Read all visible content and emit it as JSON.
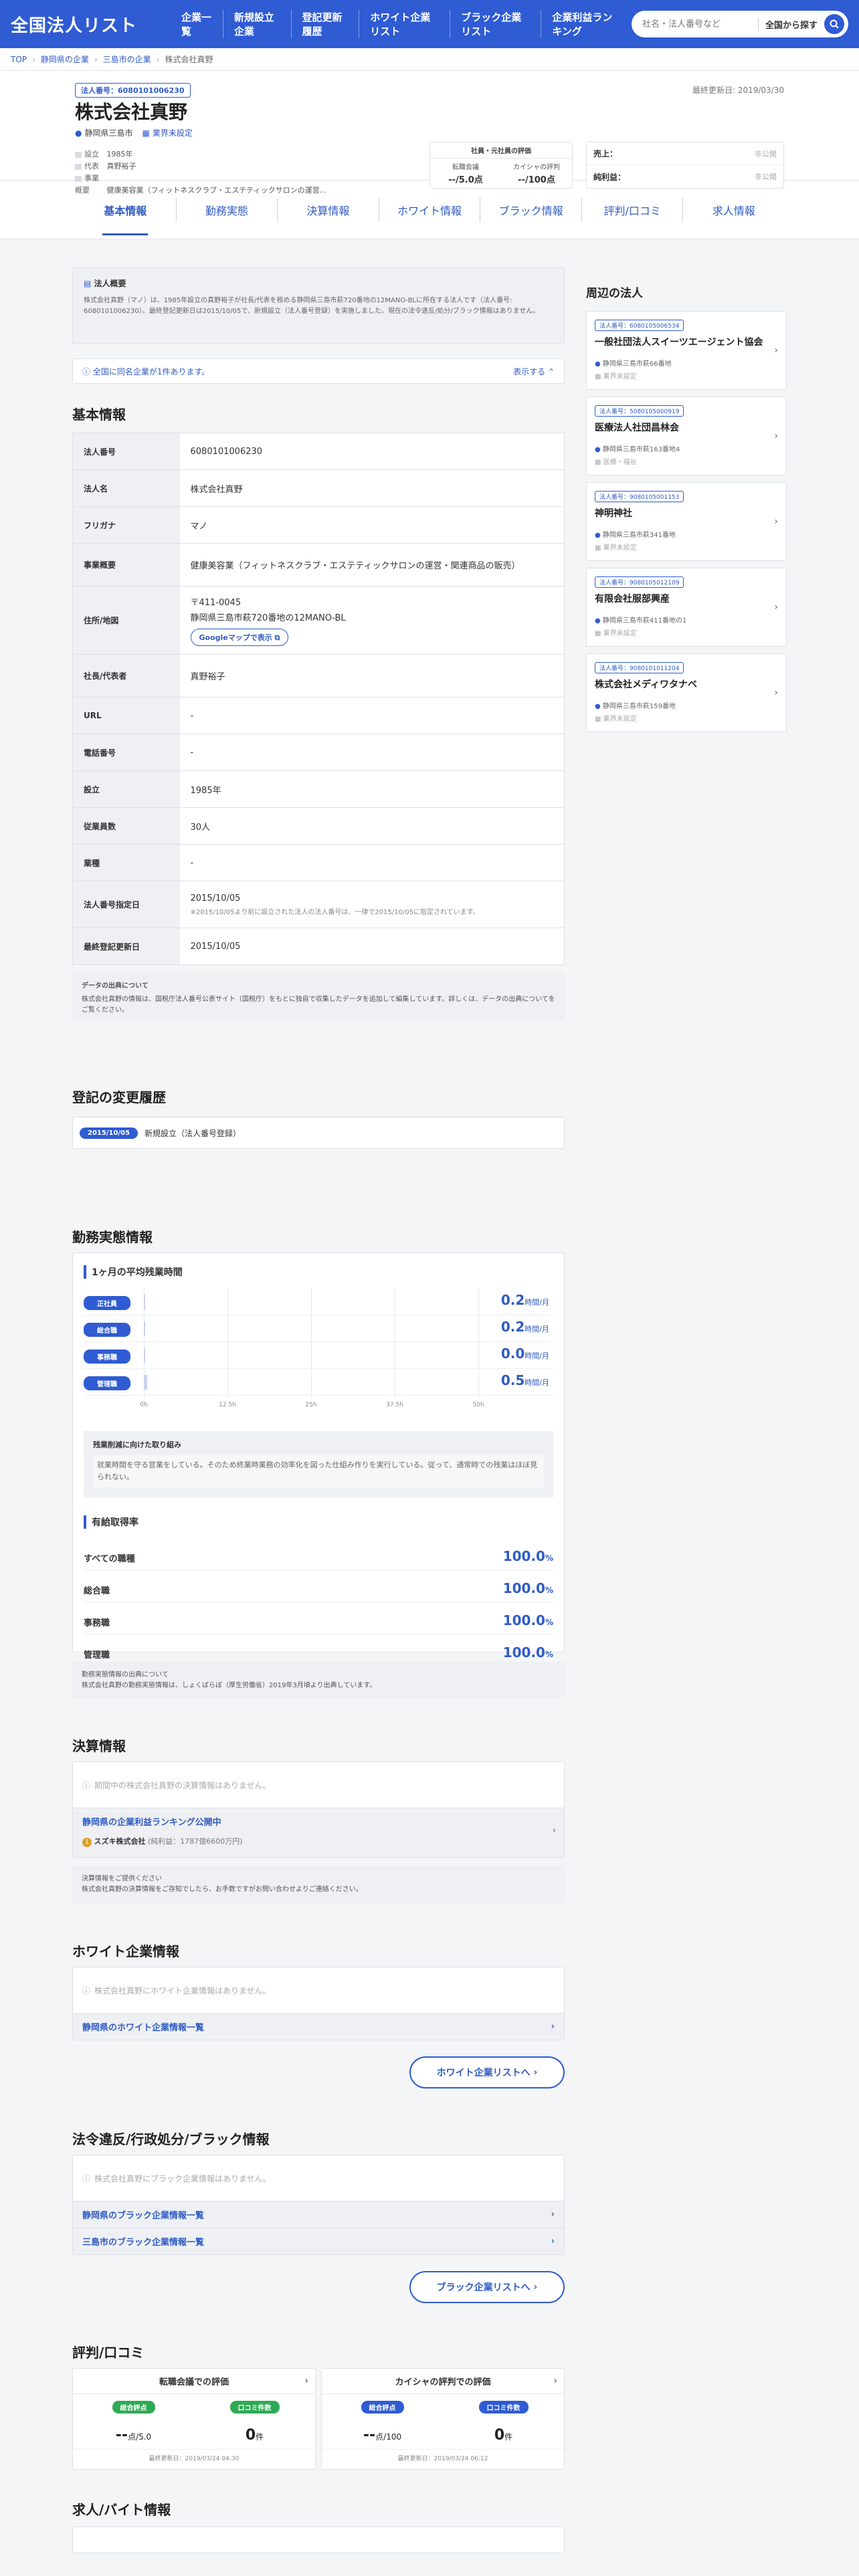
{
  "header": {
    "logo": "全国法人リスト",
    "nav": [
      "企業一覧",
      "新規設立企業",
      "登記更新履歴",
      "ホワイト企業リスト",
      "ブラック企業リスト",
      "企業利益ランキング"
    ],
    "search_placeholder": "社名・法人番号など",
    "search_scope": "全国から探す"
  },
  "breadcrumb": [
    "TOP",
    "静岡県の企業",
    "三島市の企業",
    "株式会社真野"
  ],
  "corp": {
    "number": "法人番号：6080101006230",
    "updated": "最終更新日: 2019/03/30",
    "name": "株式会社真野",
    "location": "静岡県三島市",
    "industry": "業界未設定",
    "founded_k": "設立",
    "founded_v": "1985年",
    "rep_k": "代表",
    "rep_v": "真野裕子",
    "biz_k": "事業概要",
    "biz_v": "健康美容業（フィットネスクラブ・エステティックサロンの運営...",
    "eval_title": "社員・元社員の評価",
    "eval1_k": "転職会議",
    "eval1_v": "--/5.0点",
    "eval2_k": "カイシャの評判",
    "eval2_v": "--/100点",
    "sales_k": "売上：",
    "sales_v": "非公開",
    "profit_k": "純利益：",
    "profit_v": "非公開"
  },
  "tabs": [
    "基本情報",
    "勤務実態",
    "決算情報",
    "ホワイト情報",
    "ブラック情報",
    "評判/口コミ",
    "求人情報"
  ],
  "summary": {
    "title": "法人概要",
    "text": "株式会社真野（マノ）は、1985年設立の真野裕子が社長/代表を務める静岡県三島市萩720番地の12MANO-BLに所在する法人です（法人番号: 6080101006230）。最終登記更新日は2015/10/05で、新規設立（法人番号登録）を実施しました。現在の法令違反/処分/ブラック情報はありません。"
  },
  "samename": {
    "text": "全国に同名企業が1件あります。",
    "action": "表示する"
  },
  "basic": {
    "title": "基本情報",
    "rows": [
      {
        "k": "法人番号",
        "v": "6080101006230"
      },
      {
        "k": "法人名",
        "v": "株式会社真野"
      },
      {
        "k": "フリガナ",
        "v": "マノ"
      },
      {
        "k": "事業概要",
        "v": "健康美容業（フィットネスクラブ・エステティックサロンの運営・関連商品の販売）"
      },
      {
        "k": "住所/地図",
        "v": "〒411-0045",
        "v2": "静岡県三島市萩720番地の12MANO-BL",
        "btn": "Googleマップで表示"
      },
      {
        "k": "社長/代表者",
        "v": "真野裕子"
      },
      {
        "k": "URL",
        "v": "-"
      },
      {
        "k": "電話番号",
        "v": "-"
      },
      {
        "k": "設立",
        "v": "1985年"
      },
      {
        "k": "従業員数",
        "v": "30人"
      },
      {
        "k": "業種",
        "v": "-"
      },
      {
        "k": "法人番号指定日",
        "v": "2015/10/05",
        "v2": "※2015/10/05より前に設立された法人の法人番号は、一律で2015/10/05に指定されています。"
      },
      {
        "k": "最終登記更新日",
        "v": "2015/10/05"
      }
    ]
  },
  "datasrc": {
    "title": "データの出典について",
    "text": "株式会社真野の情報は、国税庁法人番号公表サイト（国税庁）をもとに独自で収集したデータを追加して編集しています。詳しくは、データの出典についてをご覧ください。"
  },
  "history": {
    "title": "登記の変更履歴",
    "date": "2015/10/05",
    "event": "新規設立（法人番号登録）"
  },
  "work": {
    "title": "勤務実態情報",
    "overtime_title": "1ヶ月の平均残業時間",
    "chart_data": {
      "type": "bar",
      "categories": [
        "正社員",
        "総合職",
        "事務職",
        "管理職"
      ],
      "values": [
        0.2,
        0.2,
        0.0,
        0.5
      ],
      "value_labels": [
        "0.2",
        "0.2",
        "0.0",
        "0.5"
      ],
      "unit": "時間/月",
      "xlim": [
        0,
        50
      ],
      "ticks": [
        "0h",
        "12.5h",
        "25h",
        "37.5h",
        "50h"
      ]
    },
    "effort_title": "残業削減に向けた取り組み",
    "effort_text": "就業時間を守る営業をしている。そのため終業時業務の効率化を図った仕組み作りを実行している。従って、通常時での残業はほぼ見られない。",
    "leave_title": "有給取得率",
    "leave": [
      {
        "k": "すべての職種",
        "v": "100.0",
        "u": "%"
      },
      {
        "k": "総合職",
        "v": "100.0",
        "u": "%"
      },
      {
        "k": "事務職",
        "v": "100.0",
        "u": "%"
      },
      {
        "k": "管理職",
        "v": "100.0",
        "u": "%"
      }
    ],
    "src_title": "勤務実態情報の出典について",
    "src_text": "株式会社真野の勤務実態情報は、しょくばらぼ（厚生労働省）2019年3月頃より出典しています。"
  },
  "finance": {
    "title": "決算情報",
    "empty": "期間中の株式会社真野の決算情報はありません。",
    "rank_title": "静岡県の企業利益ランキング公開中",
    "rank_rank": "1",
    "rank_text": "スズキ株式会社",
    "rank_sub": "(純利益：1787億6600万円)",
    "note_title": "決算情報をご提供ください",
    "note_text": "株式会社真野の決算情報をご存知でしたら、お手数ですがお問い合わせよりご連絡ください。"
  },
  "white": {
    "title": "ホワイト企業情報",
    "empty": "株式会社真野にホワイト企業情報はありません。",
    "link": "静岡県のホワイト企業情報一覧",
    "btn": "ホワイト企業リストへ"
  },
  "black": {
    "title": "法令違反/行政処分/ブラック情報",
    "empty": "株式会社真野にブラック企業情報はありません。",
    "link1": "静岡県のブラック企業情報一覧",
    "link2": "三島市のブラック企業情報一覧",
    "btn": "ブラック企業リストへ"
  },
  "review": {
    "title": "評判/口コミ",
    "cards": [
      {
        "t": "転職会議での評価",
        "k1": "総合評点",
        "v1": "--",
        "u1": "点/5.0",
        "k2": "口コミ件数",
        "v2": "0",
        "u2": "件",
        "dt": "最終更新日：2019/03/24 04:30"
      },
      {
        "t": "カイシャの評判での評価",
        "k1": "総合評点",
        "v1": "--",
        "u1": "点/100",
        "k2": "口コミ件数",
        "v2": "0",
        "u2": "件",
        "dt": "最終更新日：2019/03/24 06:12"
      }
    ]
  },
  "jobs": {
    "title": "求人/バイト情報"
  },
  "nearby": {
    "title": "周辺の法人",
    "items": [
      {
        "no": "法人番号：6080105006534",
        "name": "一般社団法人スイーツエージェント協会",
        "addr": "静岡県三島市萩66番地",
        "ind": "業界未設定"
      },
      {
        "no": "法人番号：5080105000919",
        "name": "医療法人社団昌林会",
        "addr": "静岡県三島市萩163番地4",
        "ind": "医療・福祉"
      },
      {
        "no": "法人番号：9080105001153",
        "name": "神明神社",
        "addr": "静岡県三島市萩341番地",
        "ind": "業界未設定"
      },
      {
        "no": "法人番号：9080105012109",
        "name": "有限会社服部興産",
        "addr": "静岡県三島市萩411番地の1",
        "ind": "業界未設定"
      },
      {
        "no": "法人番号：9080101011204",
        "name": "株式会社メディワタナベ",
        "addr": "静岡県三島市萩159番地",
        "ind": "業界未設定"
      }
    ]
  }
}
